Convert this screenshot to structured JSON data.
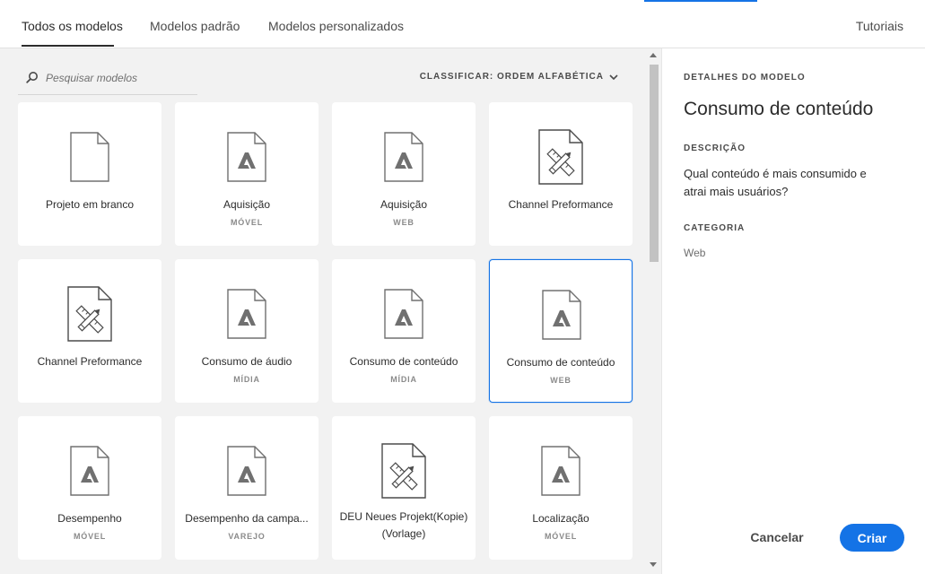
{
  "tabs": {
    "all": "Todos os modelos",
    "standard": "Modelos padrão",
    "custom": "Modelos personalizados",
    "tutorials": "Tutoriais"
  },
  "search": {
    "placeholder": "Pesquisar modelos"
  },
  "sort": {
    "label": "CLASSIFICAR: ORDEM ALFABÉTICA"
  },
  "templates": [
    {
      "title": "Projeto em branco",
      "subtitle": "",
      "icon": "blank-file-icon"
    },
    {
      "title": "Aquisição",
      "subtitle": "MÓVEL",
      "icon": "adobe-file-icon"
    },
    {
      "title": "Aquisição",
      "subtitle": "WEB",
      "icon": "adobe-file-icon"
    },
    {
      "title": "Channel Preformance",
      "subtitle": "",
      "icon": "custom-template-icon"
    },
    {
      "title": "Channel Preformance",
      "subtitle": "",
      "icon": "custom-template-icon"
    },
    {
      "title": "Consumo de áudio",
      "subtitle": "MÍDIA",
      "icon": "adobe-file-icon"
    },
    {
      "title": "Consumo de conteúdo",
      "subtitle": "MÍDIA",
      "icon": "adobe-file-icon"
    },
    {
      "title": "Consumo de conteúdo",
      "subtitle": "WEB",
      "icon": "adobe-file-icon",
      "selected": true
    },
    {
      "title": "Desempenho",
      "subtitle": "MÓVEL",
      "icon": "adobe-file-icon"
    },
    {
      "title": "Desempenho da campa...",
      "subtitle": "VAREJO",
      "icon": "adobe-file-icon"
    },
    {
      "title": "DEU Neues Projekt(Kopie) (Vorlage)",
      "subtitle": "",
      "icon": "custom-template-icon"
    },
    {
      "title": "Localização",
      "subtitle": "MÓVEL",
      "icon": "adobe-file-icon"
    }
  ],
  "details": {
    "section_label": "DETALHES DO MODELO",
    "title": "Consumo de conteúdo",
    "description_label": "DESCRIÇÃO",
    "description": "Qual conteúdo é mais consumido e atrai mais usuários?",
    "category_label": "CATEGORIA",
    "category": "Web"
  },
  "actions": {
    "cancel": "Cancelar",
    "create": "Criar"
  },
  "colors": {
    "accent": "#1473e6",
    "panel_bg": "#f2f2f2",
    "icon_gray": "#707070"
  }
}
